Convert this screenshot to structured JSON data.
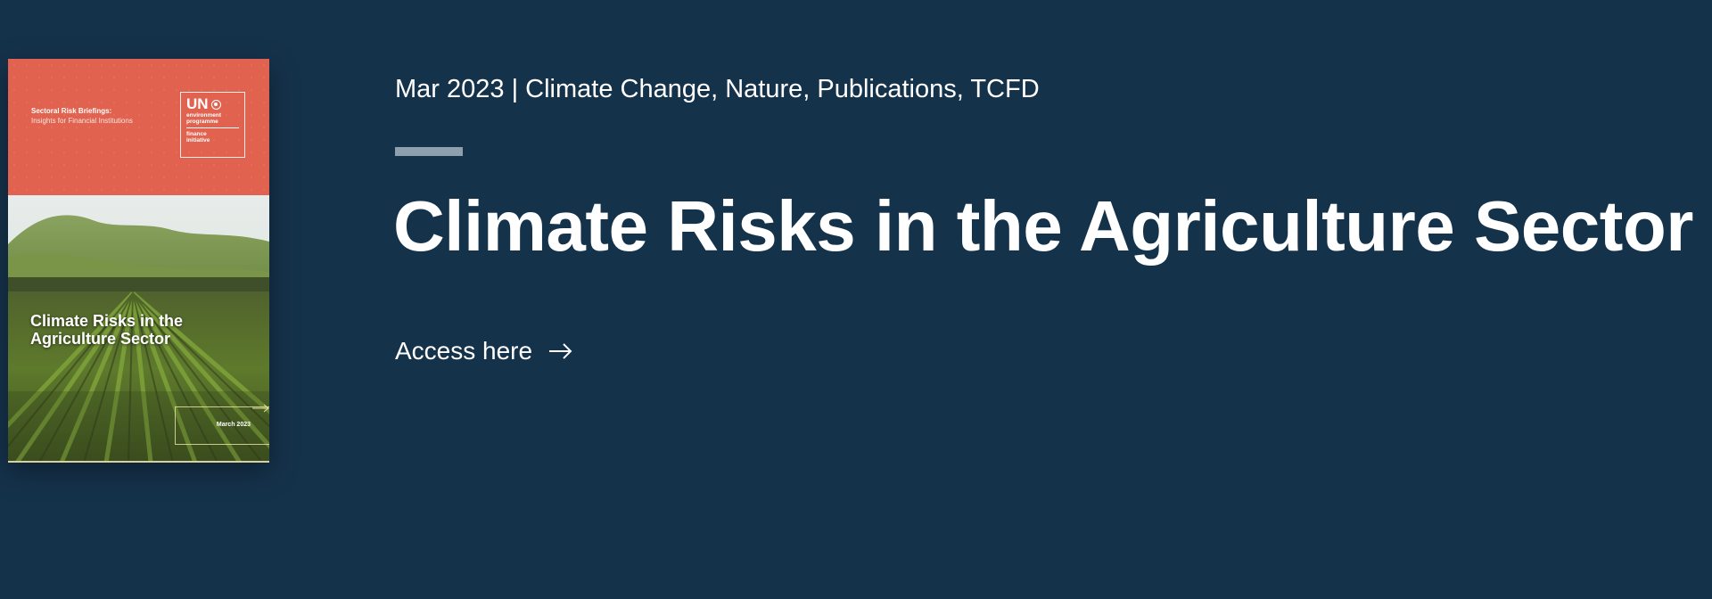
{
  "cover": {
    "series_title": "Sectoral Risk Briefings:",
    "series_subtitle": "Insights for Financial Institutions",
    "logo_un": "UN",
    "logo_programme": "environment\nprogramme",
    "logo_initiative": "finance\ninitiative",
    "title": "Climate Risks in the Agriculture Sector",
    "date": "March 2023",
    "top_color": "#e0624f",
    "accent_line_color": "#d8d1a4"
  },
  "article": {
    "meta": "Mar 2023 | Climate Change, Nature, Publications, TCFD",
    "title": "Climate Risks in the Agriculture Sector",
    "cta_label": "Access here",
    "cta_icon": "arrow-right-icon"
  },
  "theme": {
    "background": "#15324b",
    "divider": "#8e9fae",
    "text": "#ffffff"
  }
}
